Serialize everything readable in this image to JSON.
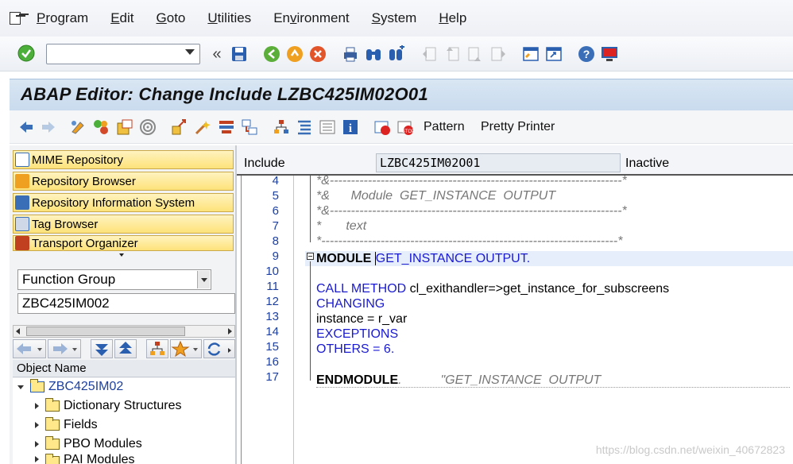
{
  "menu": {
    "items": [
      {
        "label": "Program",
        "u": "P",
        "rest": "rogram"
      },
      {
        "label": "Edit",
        "u": "E",
        "rest": "dit"
      },
      {
        "label": "Goto",
        "u": "G",
        "rest": "oto"
      },
      {
        "label": "Utilities",
        "u": "U",
        "rest": "tilities"
      },
      {
        "label": "Environment",
        "pre": "En",
        "u": "v",
        "rest": "ironment"
      },
      {
        "label": "System",
        "u": "S",
        "rest": "ystem"
      },
      {
        "label": "Help",
        "u": "H",
        "rest": "elp"
      }
    ]
  },
  "toolbar": {
    "command_value": "",
    "icons": [
      "enter-icon",
      "back-icon",
      "save-icon",
      "back-green-icon",
      "exit-icon",
      "cancel-icon",
      "print-icon",
      "find-icon",
      "find-next-icon",
      "first-page-icon",
      "prev-page-icon",
      "next-page-icon",
      "last-page-icon",
      "new-session-icon",
      "shortcut-icon",
      "help-icon",
      "customize-layout-icon"
    ]
  },
  "title": {
    "text": "ABAP Editor: Change Include LZBC425IM02O01"
  },
  "app_toolbar": {
    "pattern_label": "Pattern",
    "pretty_printer_label": "Pretty Printer"
  },
  "navigator": {
    "buttons": [
      {
        "label": "MIME Repository"
      },
      {
        "label": "Repository Browser"
      },
      {
        "label": "Repository Information System"
      },
      {
        "label": "Tag Browser"
      },
      {
        "label": "Transport Organizer"
      }
    ],
    "object_type": "Function Group",
    "object_name": "ZBC425IM002",
    "tree_header": "Object Name",
    "tree": {
      "root": "ZBC425IM02",
      "children": [
        "Dictionary Structures",
        "Fields",
        "PBO Modules",
        "PAI Modules"
      ]
    }
  },
  "editor": {
    "include_label": "Include",
    "include_value": "LZBC425IM02O01",
    "status": "Inactive",
    "line_numbers": [
      "4",
      "5",
      "6",
      "7",
      "8",
      "9",
      "10",
      "11",
      "12",
      "13",
      "14",
      "15",
      "16",
      "17"
    ],
    "lines": {
      "l4": "*&---------------------------------------------------------------------*",
      "l5": "*&      Module  GET_INSTANCE  OUTPUT",
      "l6": "*&---------------------------------------------------------------------*",
      "l7": "*       text",
      "l8": "*----------------------------------------------------------------------*",
      "l9_kw": "MODULE",
      "l9_name": "GET_INSTANCE",
      "l9_kw2": "OUTPUT.",
      "l11_kw": "CALL METHOD",
      "l11_rest": " cl_exithandler=>get_instance_for_subscreens",
      "l12": "CHANGING",
      "l13": "instance = r_var",
      "l14": "EXCEPTIONS",
      "l15_kw": "OTHERS",
      "l15_eq": " = ",
      "l15_num": "6",
      "l15_dot": ".",
      "l17_kw": "ENDMODULE",
      "l17_dot": ".",
      "l17_cmt": "\"GET_INSTANCE  OUTPUT"
    }
  },
  "watermark": "https://blog.csdn.net/weixin_40672823",
  "colors": {
    "keyword": "#1a1ad0",
    "comment": "#777777",
    "nav_button": "#fde27a",
    "title_bar": "#c9dbee"
  }
}
